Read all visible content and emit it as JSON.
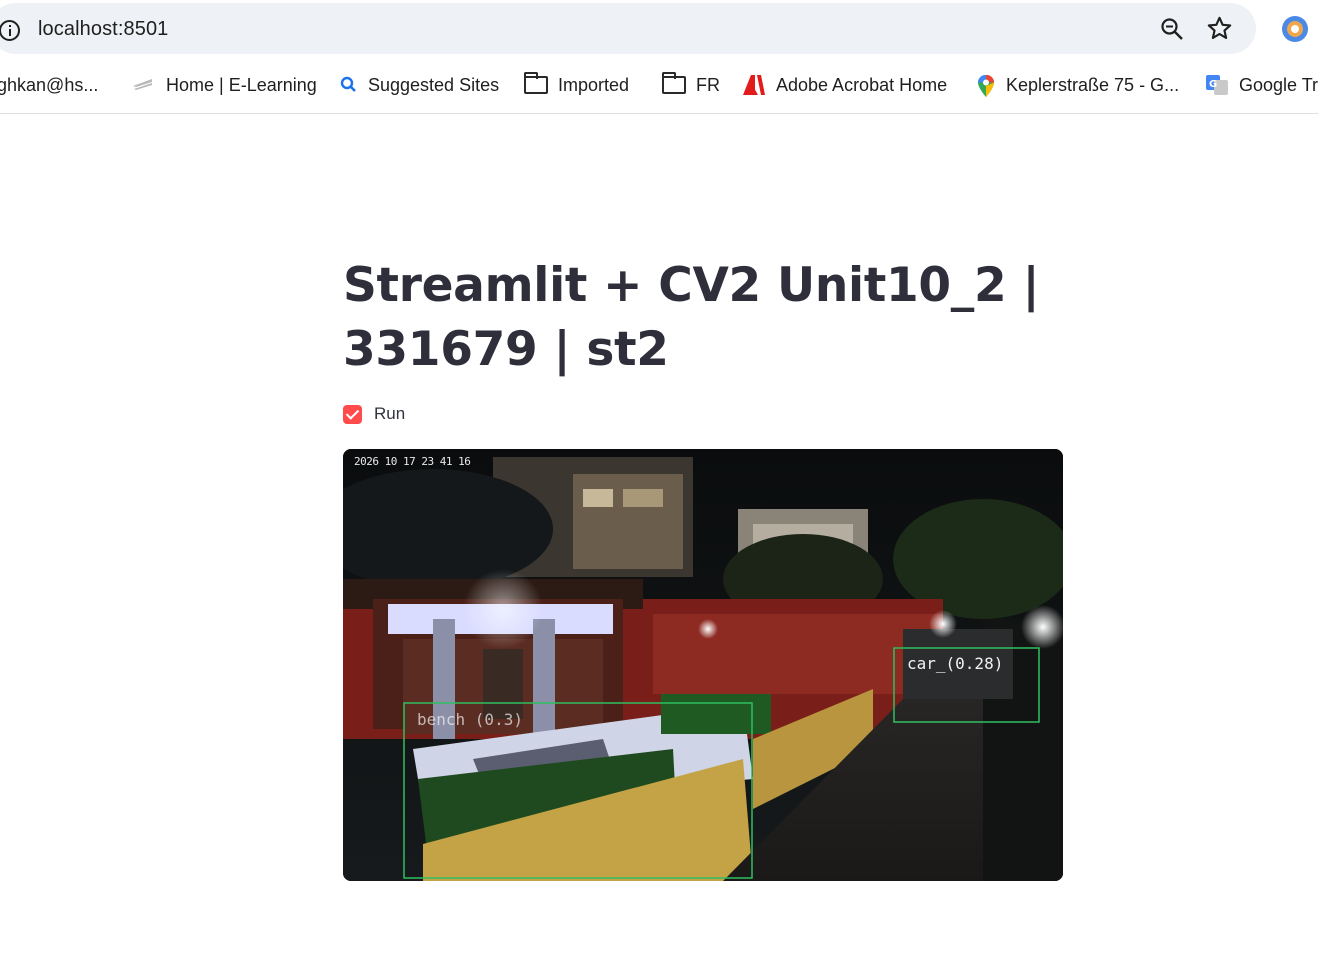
{
  "browser": {
    "url": "localhost:8501",
    "bookmarks": [
      {
        "label": "ghkan@hs...",
        "icon": "none"
      },
      {
        "label": "Home | E-Learning",
        "icon": "site-icon"
      },
      {
        "label": "Suggested Sites",
        "icon": "search-icon"
      },
      {
        "label": "Imported",
        "icon": "folder-icon"
      },
      {
        "label": "FR",
        "icon": "folder-icon"
      },
      {
        "label": "Adobe Acrobat Home",
        "icon": "adobe-icon"
      },
      {
        "label": "Keplerstraße 75 - G...",
        "icon": "maps-pin-icon"
      },
      {
        "label": "Google Tra",
        "icon": "translate-icon"
      }
    ]
  },
  "app": {
    "title": "Streamlit + CV2 Unit10_2 | 331679 | st2",
    "run_label": "Run",
    "run_checked": true,
    "accent_color": "#ff4b4b",
    "video": {
      "timestamp": "2026 10 17 23 41 16",
      "detections": [
        {
          "label": "car_(0.28)",
          "color": "#2fbf5f"
        },
        {
          "label": "bench (0.3)",
          "color": "#2fbf5f"
        }
      ]
    }
  }
}
